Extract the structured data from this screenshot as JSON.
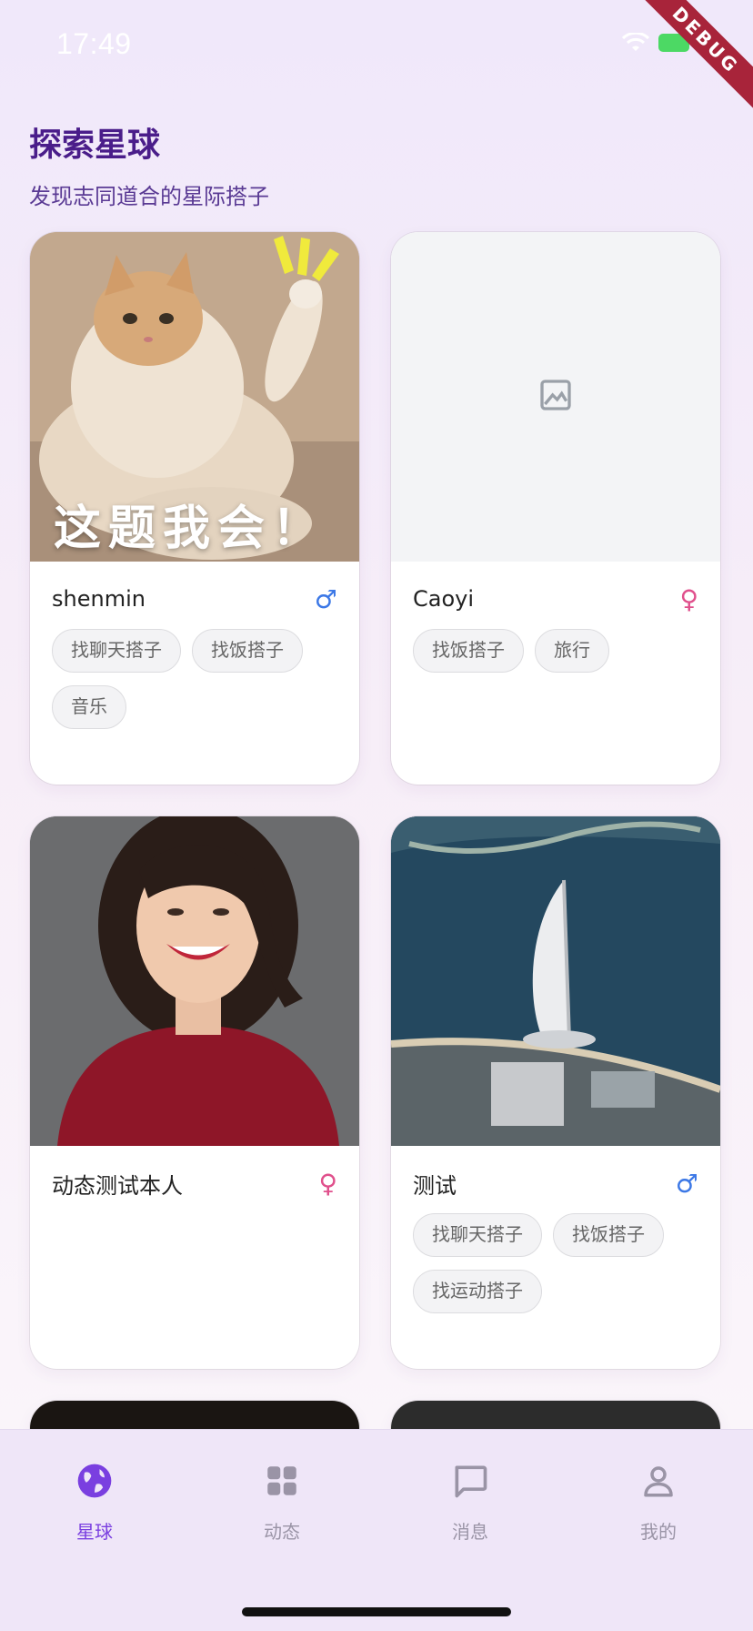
{
  "status_bar": {
    "time": "17:49",
    "debug_label": "DEBUG"
  },
  "header": {
    "title": "探索星球",
    "subtitle": "发现志同道合的星际搭子"
  },
  "cards": [
    {
      "name": "shenmin",
      "gender_symbol": "♂",
      "image_caption": "这题我会！",
      "tags": [
        "找聊天搭子",
        "找饭搭子",
        "音乐"
      ]
    },
    {
      "name": "Caoyi",
      "gender_symbol": "♀",
      "tags": [
        "找饭搭子",
        "旅行"
      ]
    },
    {
      "name": "动态测试本人",
      "gender_symbol": "♀",
      "tags": []
    },
    {
      "name": "测试",
      "gender_symbol": "♂",
      "tags": [
        "找聊天搭子",
        "找饭搭子",
        "找运动搭子"
      ]
    }
  ],
  "tabs": [
    {
      "label": "星球",
      "icon": "globe-icon",
      "active": true
    },
    {
      "label": "动态",
      "icon": "grid-icon",
      "active": false
    },
    {
      "label": "消息",
      "icon": "chat-icon",
      "active": false
    },
    {
      "label": "我的",
      "icon": "person-icon",
      "active": false
    }
  ],
  "colors": {
    "accent": "#7a3fe0",
    "title": "#4a1d8a",
    "male": "#3c78e6",
    "female": "#e0508c"
  }
}
